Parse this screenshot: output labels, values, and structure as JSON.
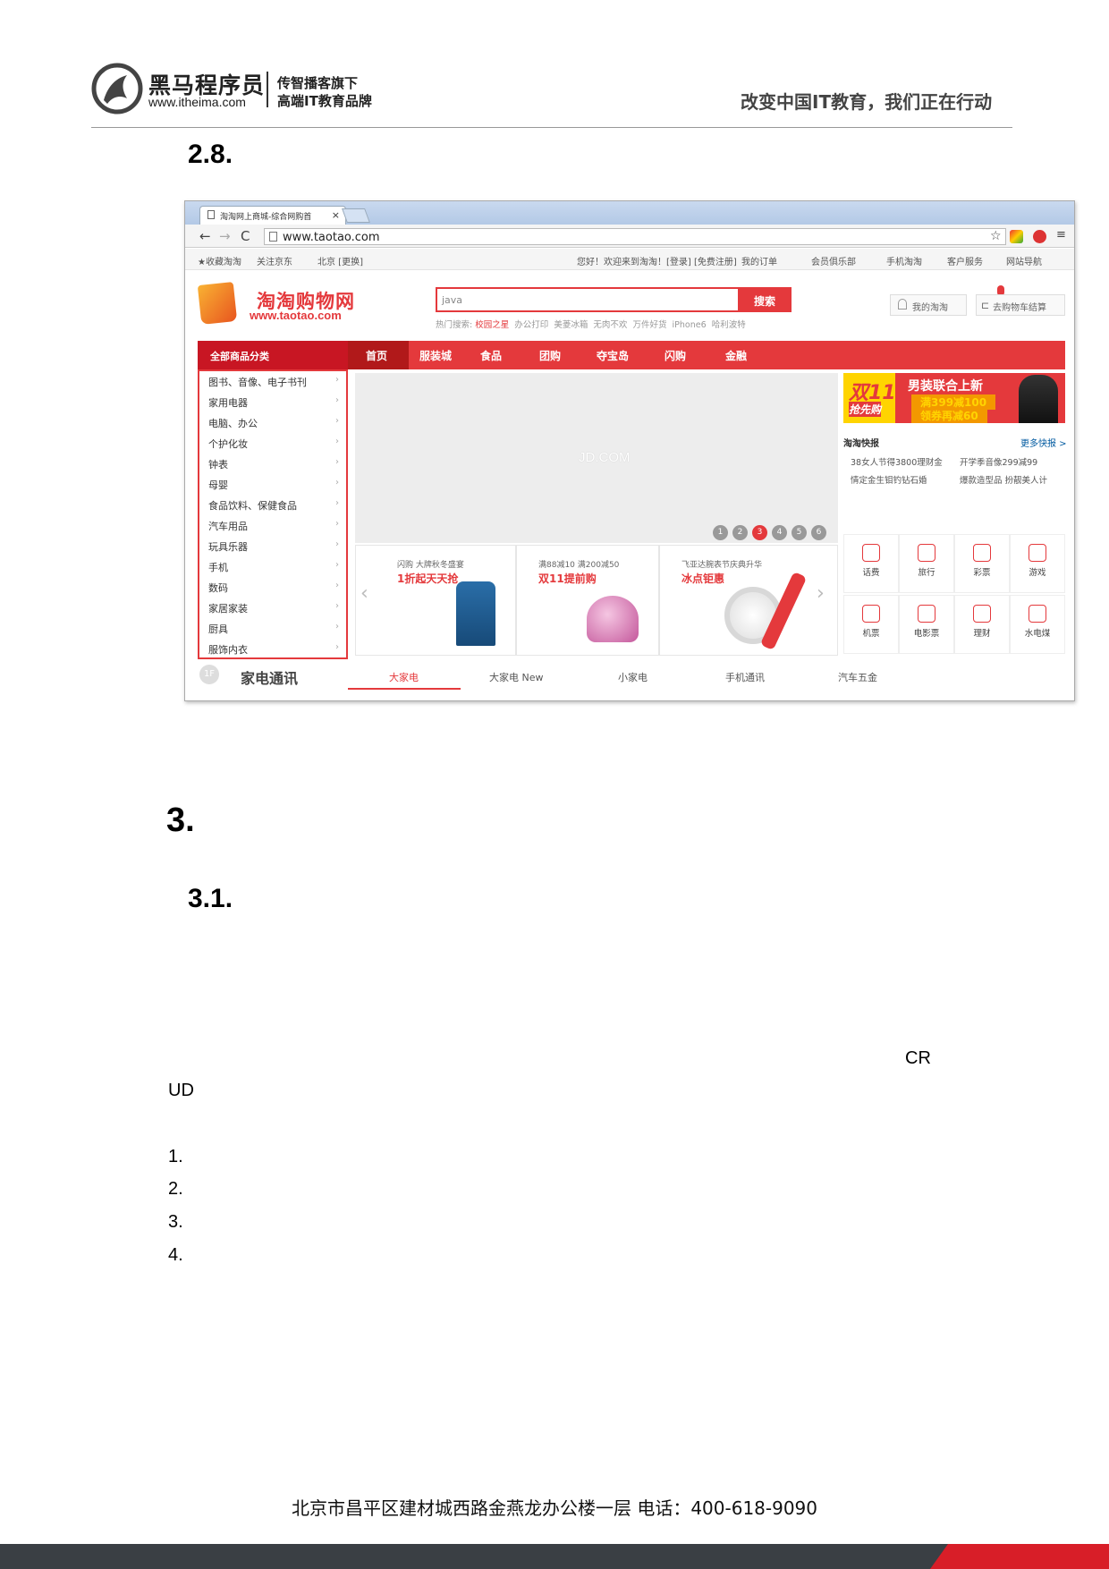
{
  "header": {
    "brand_name": "黑马程序员",
    "brand_url": "www.itheima.com",
    "tagline_line1": "传智播客旗下",
    "tagline_line2": "高端IT教育品牌",
    "slogan": "改变中国IT教育，我们正在行动"
  },
  "doc": {
    "heading_2_8": "2.8.",
    "heading_3": "3.",
    "heading_3_1": "3.1.",
    "para_fragment_1": "CR",
    "para_fragment_2": "UD",
    "list": [
      "1.",
      "2.",
      "3.",
      "4."
    ]
  },
  "screenshot": {
    "tab_title": "淘淘网上商城-综合网购首",
    "tab_close": "×",
    "url": "www.taotao.com",
    "topbar": {
      "fav": "★收藏淘淘",
      "follow": "关注京东",
      "location": "北京 [更换]",
      "welcome": "您好！欢迎来到淘淘！[登录] [免费注册]",
      "orders": "我的订单",
      "club": "会员俱乐部",
      "mobile": "手机淘淘",
      "service": "客户服务",
      "sitenav": "网站导航"
    },
    "site_name": "淘淘购物网",
    "site_url": "www.taotao.com",
    "search_value": "java",
    "search_button": "搜索",
    "hot_label": "热门搜索:",
    "hot_words": [
      "校园之星",
      "办公打印",
      "美菱冰箱",
      "无肉不欢",
      "万件好货",
      "iPhone6",
      "哈利波特"
    ],
    "my_account": "我的淘淘",
    "cart": "去购物车结算",
    "nav_all": "全部商品分类",
    "nav_items": [
      "首页",
      "服装城",
      "食品",
      "团购",
      "夺宝岛",
      "闪购",
      "金融"
    ],
    "categories": [
      "图书、音像、电子书刊",
      "家用电器",
      "电脑、办公",
      "个护化妆",
      "钟表",
      "母婴",
      "食品饮料、保健食品",
      "汽车用品",
      "玩具乐器",
      "手机",
      "数码",
      "家居家装",
      "厨具",
      "服饰内衣"
    ],
    "slider_logo": "JD.COM",
    "slider_dots": [
      "1",
      "2",
      "3",
      "4",
      "5",
      "6"
    ],
    "slider_active": 3,
    "promos": [
      {
        "small": "闪购  大牌秋冬盛宴",
        "big": "1折起天天抢"
      },
      {
        "small": "满88减10 满200减50",
        "big": "双11提前购"
      },
      {
        "small": "飞亚达腕表节庆典升华",
        "big": "冰点钜惠"
      }
    ],
    "banner": {
      "left_big": "双11",
      "left_small": "抢先购",
      "title": "男装联合上新",
      "line1": "满399减100",
      "line2": "领券再减60"
    },
    "kuaibao_title": "淘淘快报",
    "kuaibao_more": "更多快报 >",
    "news": [
      "38女人节得3800理财金",
      "开学季音像299减99",
      "情定金生钼钓钻石婚",
      "爆款造型品 扮靓美人计"
    ],
    "services": [
      "话费",
      "旅行",
      "彩票",
      "游戏",
      "机票",
      "电影票",
      "理财",
      "水电煤"
    ],
    "floor_badge": "1F",
    "floor_title": "家电通讯",
    "floor_tabs": [
      "大家电",
      "大家电 New",
      "小家电",
      "手机通讯",
      "汽车五金"
    ]
  },
  "footer": {
    "address": "北京市昌平区建材城西路金燕龙办公楼一层   电话：400-618-9090"
  },
  "colors": {
    "accent": "#e4393c",
    "footer": "#3a3f44"
  }
}
